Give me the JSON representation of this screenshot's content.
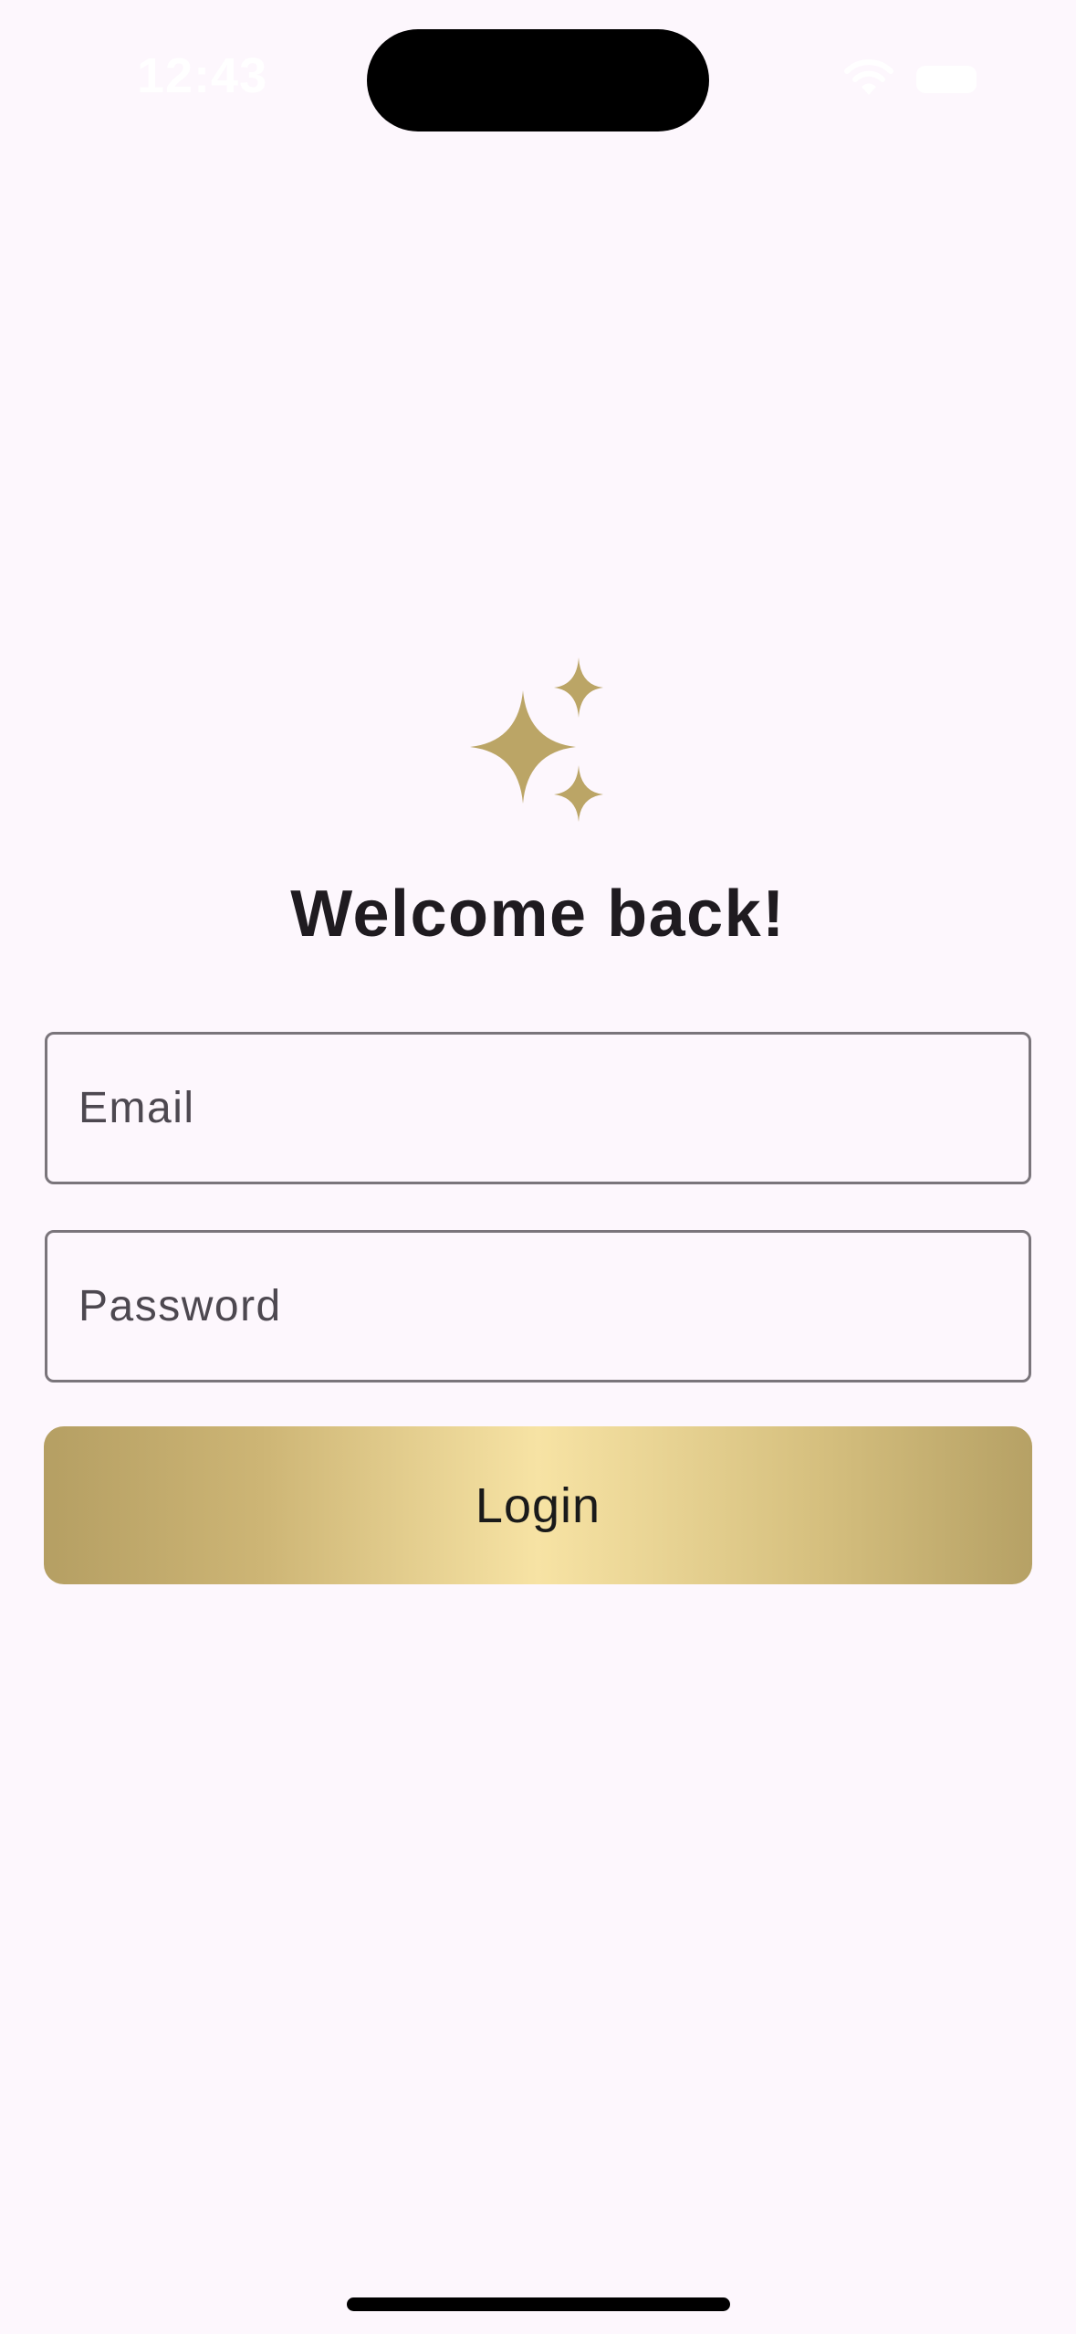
{
  "status_bar": {
    "time": "12:43",
    "icons": [
      "wifi-icon",
      "battery-icon"
    ]
  },
  "logo": {
    "icon": "sparkles-icon",
    "color": "#bba566"
  },
  "login_form": {
    "title": "Welcome back!",
    "email": {
      "placeholder": "Email",
      "value": ""
    },
    "password": {
      "placeholder": "Password",
      "value": ""
    },
    "login_label": "Login"
  },
  "colors": {
    "background": "#fdf7fd",
    "field_border": "#7a757b",
    "button_gradient": [
      "#b59f63",
      "#f7e3a4",
      "#b6a165"
    ],
    "title_text": "#1f1b20"
  }
}
